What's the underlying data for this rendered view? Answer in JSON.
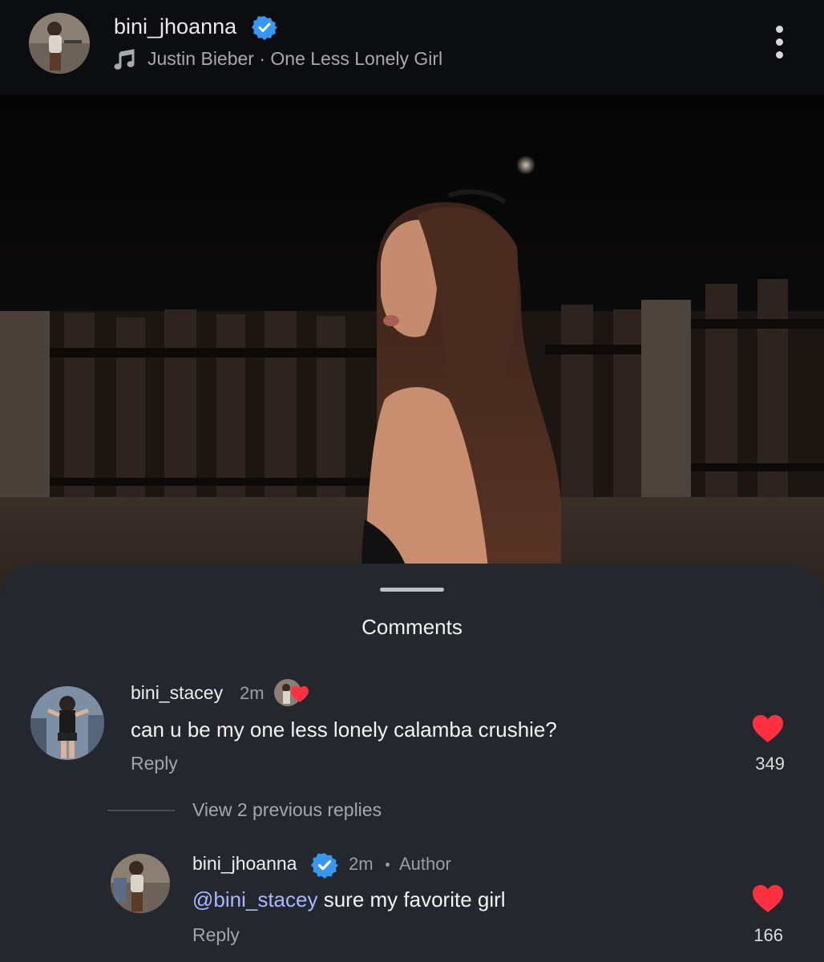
{
  "header": {
    "username": "bini_jhoanna",
    "song": "Justin Bieber · One Less Lonely Girl"
  },
  "sheet": {
    "title": "Comments",
    "view_previous_replies": "View 2 previous replies"
  },
  "comments": [
    {
      "username": "bini_stacey",
      "time": "2m",
      "text": "can u be my one less lonely calamba crushie?",
      "reply_label": "Reply",
      "likes": "349"
    }
  ],
  "replies": [
    {
      "username": "bini_jhoanna",
      "time": "2m",
      "author_badge": "Author",
      "mention": "@bini_stacey",
      "text": " sure my favorite girl",
      "reply_label": "Reply",
      "likes": "166"
    }
  ],
  "colors": {
    "header_bg": "#0c0d10",
    "sheet_bg": "#25272e",
    "verified_blue": "#3897f0",
    "like_red": "#ff3040",
    "mention_blue": "#a9b7ff"
  },
  "icons": [
    "music-note-icon",
    "verified-badge-icon",
    "more-options-icon",
    "heart-icon"
  ]
}
